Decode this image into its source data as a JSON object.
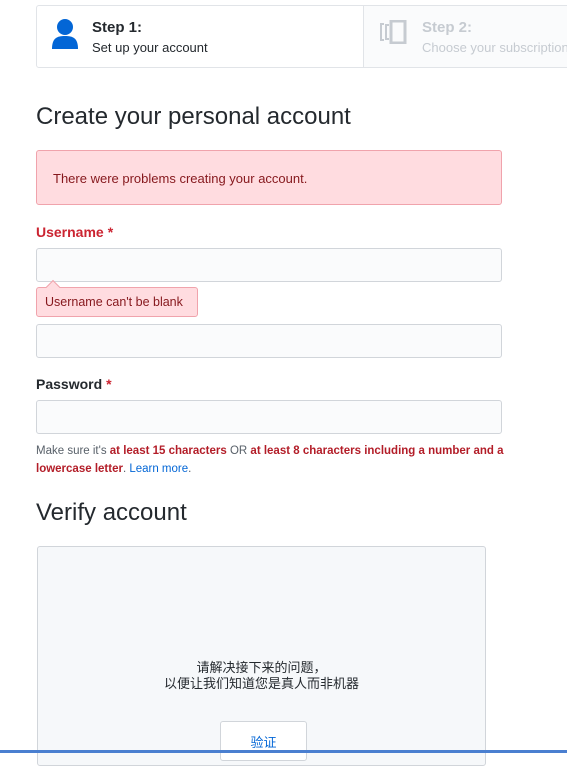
{
  "steps": [
    {
      "number": "Step 1:",
      "description": "Set up your account",
      "icon": "user-icon",
      "active": true
    },
    {
      "number": "Step 2:",
      "description": "Choose your subscription",
      "icon": "repo-icon",
      "active": false
    }
  ],
  "page_title": "Create your personal account",
  "flash_error": "There were problems creating your account.",
  "form": {
    "username": {
      "label": "Username",
      "required_mark": "*",
      "value": "",
      "error": "Username can't be blank"
    },
    "email": {
      "value": ""
    },
    "password": {
      "label": "Password",
      "required_mark": "*",
      "value": ""
    },
    "password_note": {
      "prefix": "Make sure it's ",
      "rule1": "at least 15 characters",
      "or": " OR ",
      "rule2": "at least 8 characters including a number and a lowercase letter",
      "dot": ". ",
      "link": "Learn more",
      "end": "."
    }
  },
  "verify": {
    "heading": "Verify account",
    "prompt_line1": "请解决接下来的问题，",
    "prompt_line2": "以便让我们知道您是真人而非机器",
    "button": "验证"
  },
  "colors": {
    "error": "#cb2431",
    "accent": "#0366d6",
    "user_icon": "#0366d6"
  }
}
